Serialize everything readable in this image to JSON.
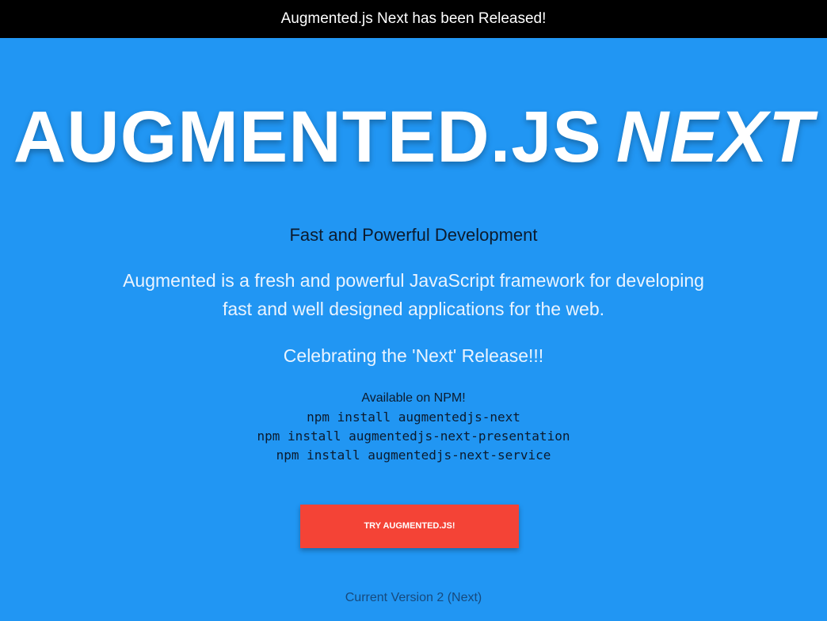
{
  "banner": {
    "text": "Augmented.js Next has been Released!"
  },
  "hero": {
    "title_main": "AUGMENTED.JS",
    "title_accent": "NEXT"
  },
  "content": {
    "subtitle": "Fast and Powerful Development",
    "description_line1": "Augmented is a fresh and powerful JavaScript framework for developing",
    "description_line2": "fast and well designed applications for the web.",
    "celebrate": "Celebrating the 'Next' Release!!!",
    "npm_label": "Available on NPM!",
    "npm_commands": [
      "npm install augmentedjs-next",
      "npm install augmentedjs-next-presentation",
      "npm install augmentedjs-next-service"
    ]
  },
  "cta": {
    "label": "TRY AUGMENTED.JS!"
  },
  "footer": {
    "version": "Current Version 2 (Next)"
  },
  "colors": {
    "background": "#2196F3",
    "banner": "#000000",
    "button": "#F44336"
  }
}
